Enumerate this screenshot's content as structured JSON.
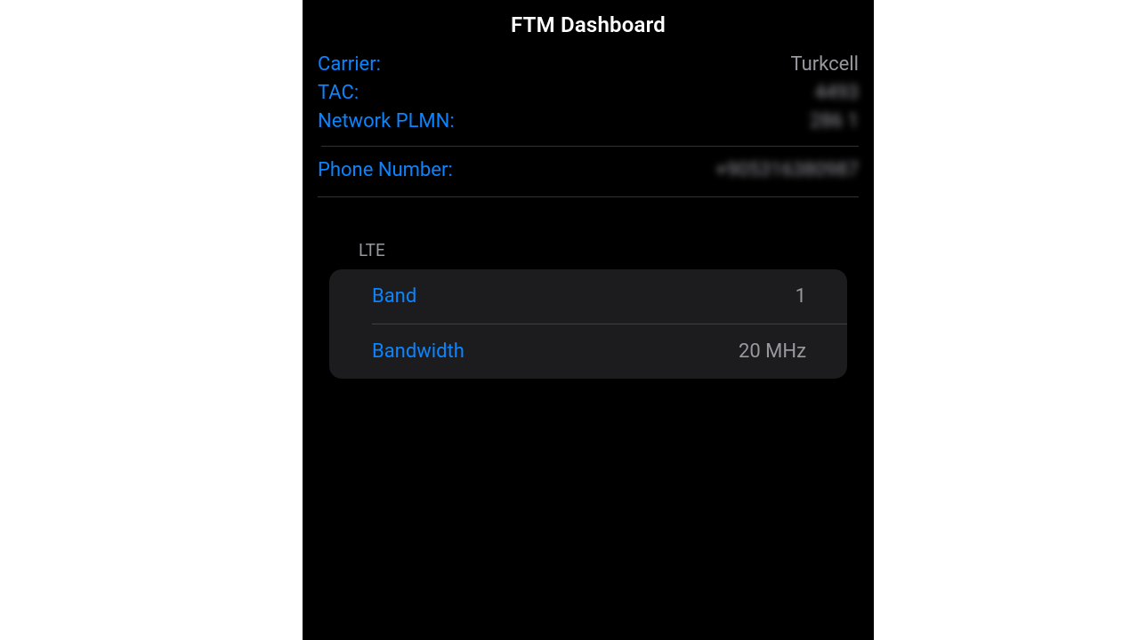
{
  "header": {
    "title": "FTM Dashboard"
  },
  "info": {
    "carrier_label": "Carrier:",
    "carrier_value": "Turkcell",
    "tac_label": "TAC:",
    "tac_value": "4493",
    "plmn_label": "Network PLMN:",
    "plmn_value": "286 1",
    "phone_label": "Phone Number:",
    "phone_value": "+905316380987"
  },
  "lte": {
    "heading": "LTE",
    "band_label": "Band",
    "band_value": "1",
    "bandwidth_label": "Bandwidth",
    "bandwidth_value": "20 MHz"
  }
}
